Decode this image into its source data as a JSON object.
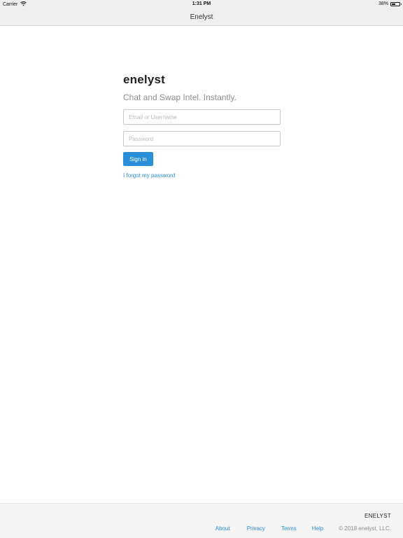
{
  "status_bar": {
    "carrier": "Carrier",
    "time": "1:31 PM",
    "battery": "38%",
    "battery_level": 0.38
  },
  "nav": {
    "title": "Enelyst"
  },
  "login": {
    "brand": "enelyst",
    "tagline": "Chat and Swap Intel. Instantly.",
    "username_placeholder": "Email or Username",
    "username_value": "",
    "password_placeholder": "Password",
    "password_value": "",
    "signin_label": "Sign in",
    "forgot_label": "I forgot my password"
  },
  "footer": {
    "brand": "ENELYST",
    "links": [
      "About",
      "Privacy",
      "Terms",
      "Help"
    ],
    "copyright": "© 2018 enelyst, LLC."
  },
  "colors": {
    "accent": "#2b8ed9",
    "bar_bg": "#efefef",
    "footer_bg": "#f5f5f5"
  }
}
